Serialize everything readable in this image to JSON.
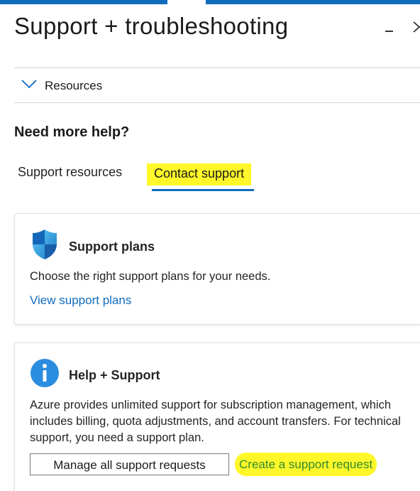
{
  "header": {
    "title": "Support + troubleshooting",
    "minimize_icon": "minimize-icon",
    "close_icon": "close-chevron-icon"
  },
  "resources": {
    "label": "Resources",
    "expanded": true,
    "icon": "chevron-down-icon"
  },
  "help": {
    "heading": "Need more help?"
  },
  "tabs": [
    {
      "label": "Support resources",
      "selected": false
    },
    {
      "label": "Contact support",
      "selected": true,
      "highlighted": true
    }
  ],
  "cards": {
    "support_plans": {
      "icon": "shield-icon",
      "title": "Support plans",
      "description": "Choose the right support plans for your needs.",
      "link": "View support plans"
    },
    "help_support": {
      "icon": "info-icon",
      "title": "Help + Support",
      "description": "Azure provides unlimited support for subscription management, which includes billing, quota adjustments, and account transfers. For technical support, you need a support plan.",
      "manage_button": "Manage all support requests",
      "create_link": "Create a support request"
    }
  },
  "colors": {
    "accent": "#0f6cbd",
    "highlight": "#fff72a",
    "create_link_text": "#2e8b2e"
  }
}
